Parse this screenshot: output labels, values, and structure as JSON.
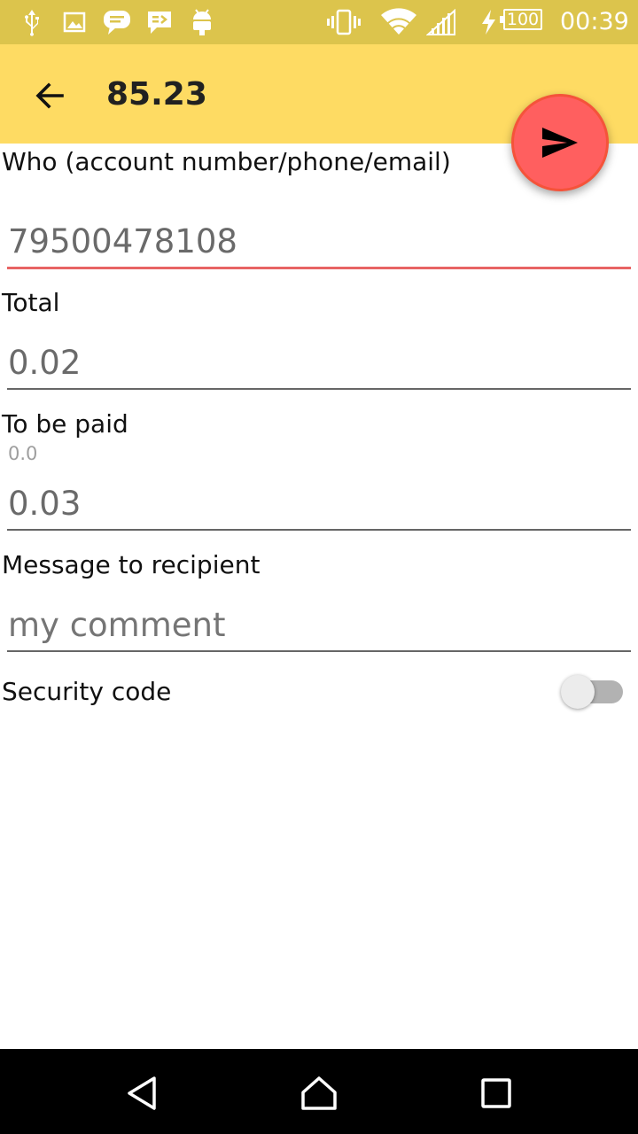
{
  "status_bar": {
    "time": "00:39",
    "battery_level": "100",
    "icons": [
      "usb-icon",
      "image-icon",
      "chat-bubble-icon",
      "message-icon",
      "android-icon",
      "vibrate-icon",
      "wifi-icon",
      "cellular-signal-icon",
      "charging-bolt-icon",
      "battery-icon"
    ],
    "background_color": "#dcc44c"
  },
  "toolbar": {
    "title": "85.23",
    "back_icon": "arrow-back-icon",
    "background_color": "#fedb63"
  },
  "fab": {
    "icon": "send-icon",
    "color": "#ff5f5f"
  },
  "form": {
    "recipient": {
      "label": "Who (account number/phone/email)",
      "value": "79500478108"
    },
    "total": {
      "label": "Total",
      "value": "0.02"
    },
    "to_be_paid": {
      "label": "To be paid",
      "hint": "0.0",
      "value": "0.03"
    },
    "message": {
      "label": "Message to recipient",
      "placeholder": "my comment"
    },
    "security_code": {
      "label": "Security code",
      "enabled": false
    }
  },
  "nav_bar": {
    "buttons": [
      "back-triangle-icon",
      "home-icon",
      "recents-icon"
    ]
  }
}
